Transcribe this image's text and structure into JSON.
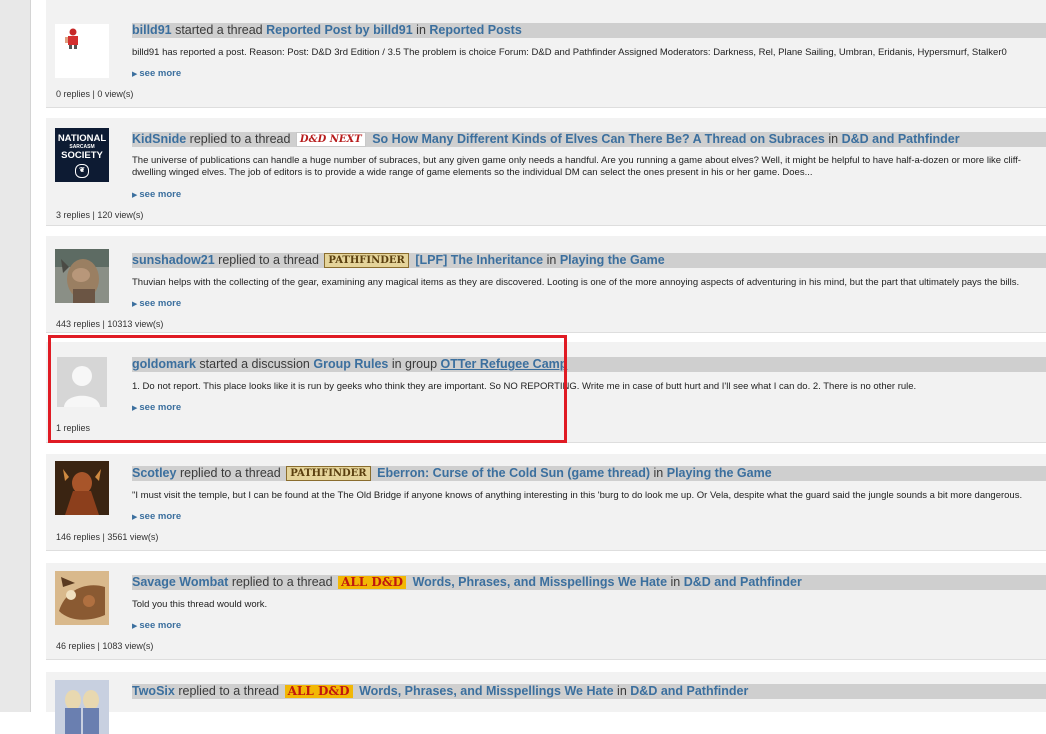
{
  "items": [
    {
      "user": "billd91",
      "action": "started a thread",
      "title": "Reported Post by billd91",
      "in_word": "in",
      "forum": "Reported Posts",
      "body": "billd91 has reported a post. Reason: Post: D&D 3rd Edition / 3.5 The problem is choice Forum: D&D and Pathfinder Assigned Moderators: Darkness, Rel, Plane Sailing, Umbran, Eridanis, Hypersmurf, Stalker0",
      "see_more": "see more",
      "stats": "0 replies | 0 view(s)"
    },
    {
      "user": "KidSnide",
      "action": "replied to a thread",
      "prefix": "D&D NEXT",
      "title": "So How Many Different Kinds of Elves Can There Be? A Thread on Subraces",
      "in_word": "in",
      "forum": "D&D and Pathfinder",
      "avatar_lines": [
        "NATIONAL",
        "SARCASM",
        "SOCIETY"
      ],
      "body": "The universe of publications can handle a huge number of subraces, but any given game only needs a handful. Are you running a game about elves? Well, it might be helpful to have half-a-dozen or more like cliff-dwelling winged elves. The job of editors is to provide a wide range of game elements so the individual DM can select the ones present in his or her game. Does...",
      "see_more": "see more",
      "stats": "3 replies | 120 view(s)"
    },
    {
      "user": "sunshadow21",
      "action": "replied to a thread",
      "prefix": "PATHFINDER",
      "title": "[LPF] The Inheritance",
      "in_word": "in",
      "forum": "Playing the Game",
      "body": "Thuvian helps with the collecting of the gear, examining any magical items as they are discovered. Looting is one of the more annoying aspects of adventuring in his mind, but the part that ultimately pays the bills.",
      "see_more": "see more",
      "stats": "443 replies | 10313 view(s)"
    },
    {
      "user": "goldomark",
      "action": "started a discussion",
      "title": "Group Rules",
      "in_word": "in group",
      "forum": "OTTer Refugee Camp",
      "body": "1. Do not report. This place looks like it is run by geeks who think they are important. So NO REPORTING. Write me in case of butt hurt and I'll see what I can do. 2. There is no other rule.",
      "see_more": "see more",
      "stats": "1 replies"
    },
    {
      "user": "Scotley",
      "action": "replied to a thread",
      "prefix": "PATHFINDER",
      "title": "Eberron: Curse of the Cold Sun (game thread)",
      "in_word": "in",
      "forum": "Playing the Game",
      "body": "\"I must visit the temple, but I can be found at the The Old Bridge if anyone knows of anything interesting in this 'burg to do look me up. Or Vela, despite what the guard said the jungle sounds a bit more dangerous.",
      "see_more": "see more",
      "stats": "146 replies | 3561 view(s)"
    },
    {
      "user": "Savage Wombat",
      "action": "replied to a thread",
      "prefix": "ALL D&D",
      "title": "Words, Phrases, and Misspellings We Hate",
      "in_word": "in",
      "forum": "D&D and Pathfinder",
      "body": "Told you this thread would work.",
      "see_more": "see more",
      "stats": "46 replies | 1083 view(s)"
    },
    {
      "user": "TwoSix",
      "action": "replied to a thread",
      "prefix": "ALL D&D",
      "title": "Words, Phrases, and Misspellings We Hate",
      "in_word": "in",
      "forum": "D&D and Pathfinder"
    }
  ],
  "colors": {
    "link": "#3b6f9e",
    "highlight": "#e01b24",
    "header_bar": "#cfcfcf",
    "item_bg": "#f2f2f2"
  }
}
